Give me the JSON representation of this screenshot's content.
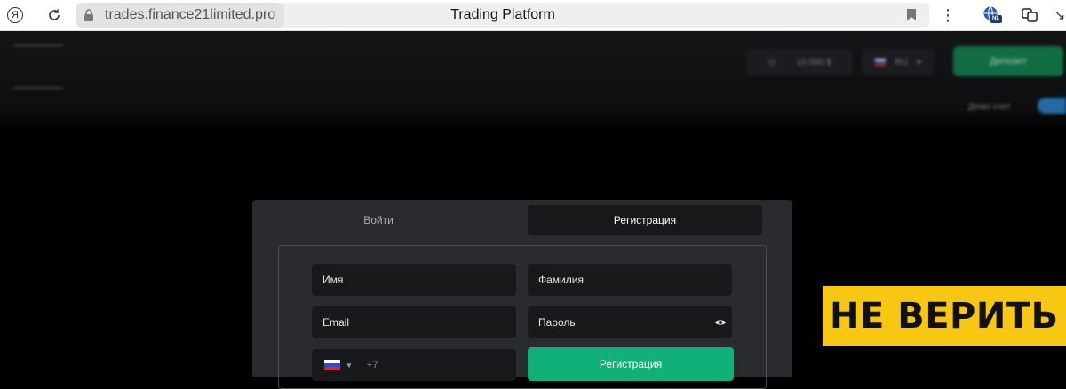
{
  "browser": {
    "url": "trades.finance21limited.pro",
    "tab_title": "Trading Platform",
    "yandex_icon_glyph": "Я",
    "extension_badge": "NL"
  },
  "site_header": {
    "balance_text": "10 000 $",
    "currency_code": "RU",
    "deposit_label": "Депозит",
    "account_mode_label": "Демо счет"
  },
  "auth": {
    "tabs": [
      {
        "label": "Войти",
        "active": false
      },
      {
        "label": "Регистрация",
        "active": true
      }
    ],
    "form": {
      "first_name_placeholder": "Имя",
      "last_name_placeholder": "Фамилия",
      "email_placeholder": "Email",
      "password_placeholder": "Пароль",
      "phone_code": "+7",
      "submit_label": "Регистрация"
    }
  },
  "overlay": {
    "warning_text": "НЕ ВЕРИТЬ"
  },
  "colors": {
    "modal_bg": "#2a2b2e",
    "field_bg": "#18191b",
    "submit_green": "#10b079",
    "warning_yellow": "#f7c711"
  }
}
